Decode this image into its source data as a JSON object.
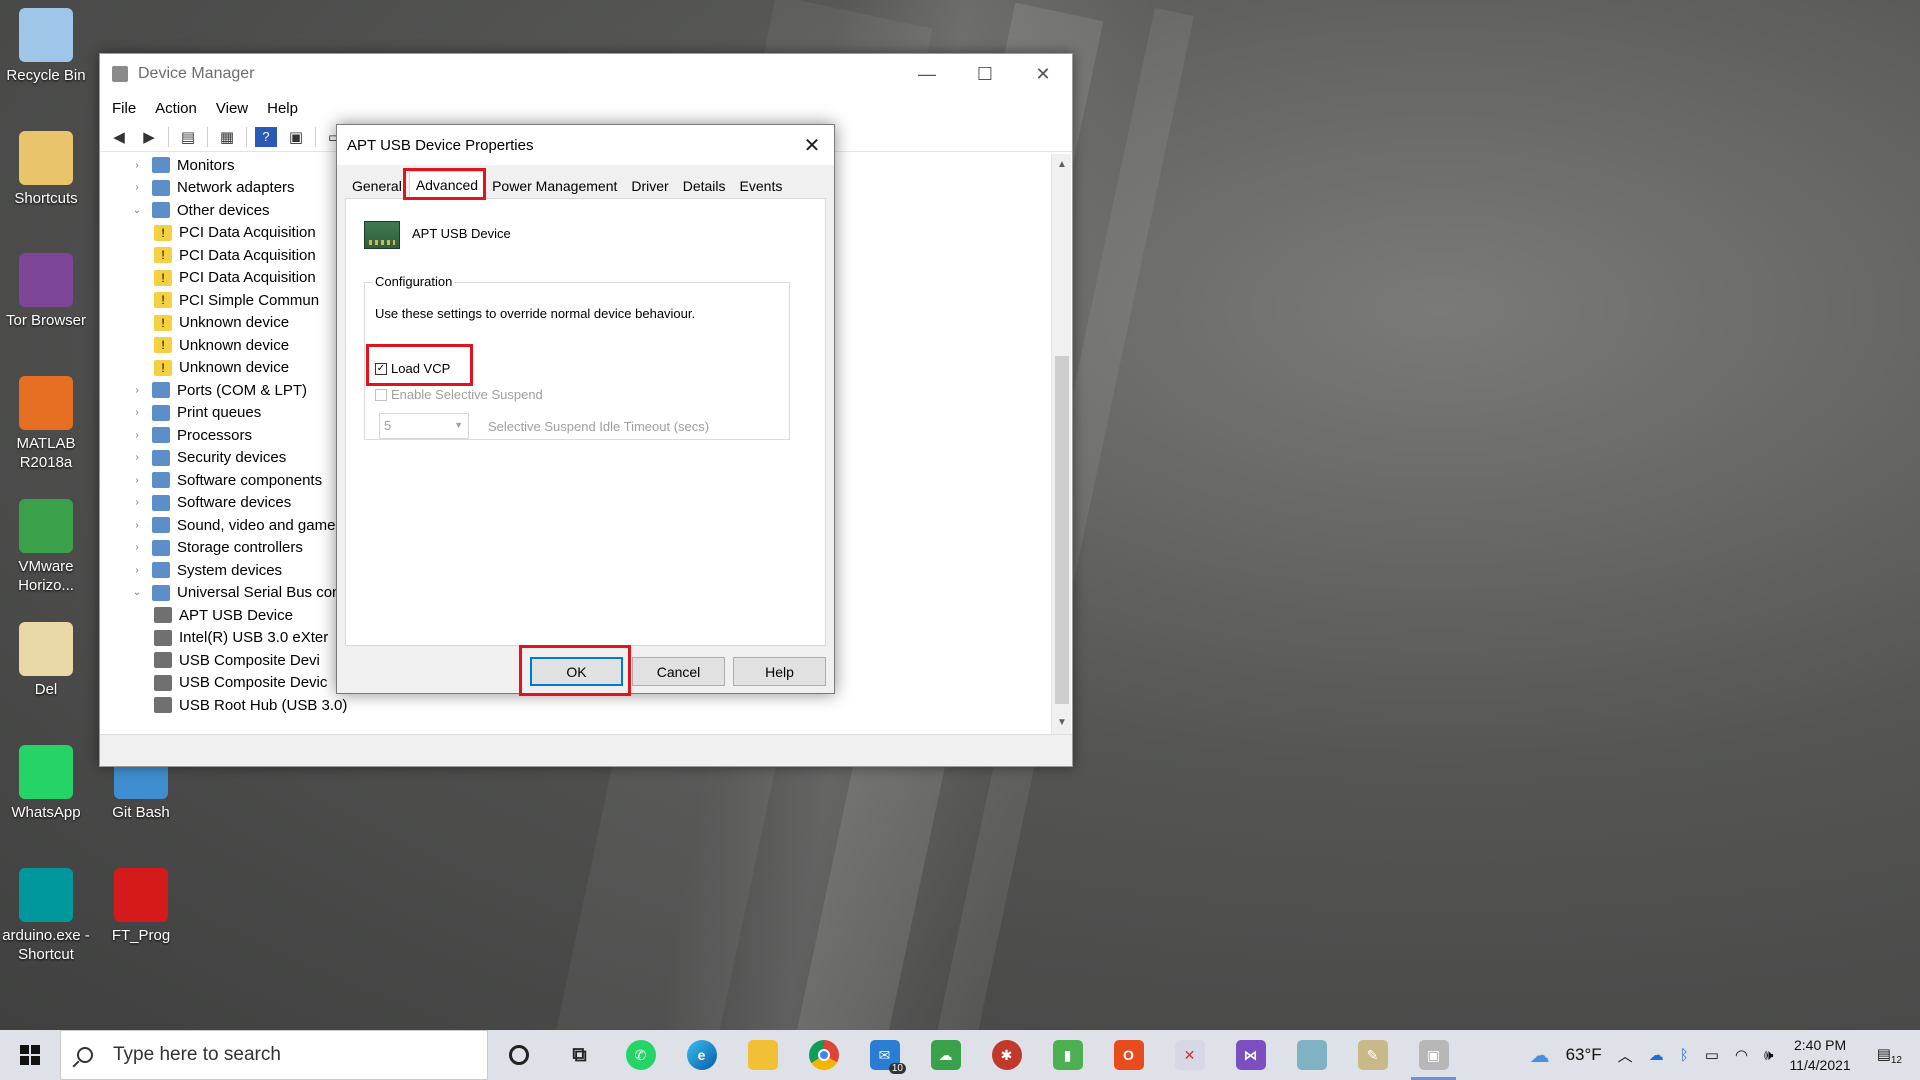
{
  "desktop": {
    "icons": [
      {
        "label": "Recycle Bin",
        "icon": "recycle-bin-icon",
        "color": "#9fc6e8"
      },
      {
        "label": "Shortcuts",
        "icon": "folder-icon",
        "color": "#e9c46a"
      },
      {
        "label": "Tor Browser",
        "icon": "tor-icon",
        "color": "#7d4698"
      },
      {
        "label": "MATLAB R2018a",
        "icon": "matlab-icon",
        "color": "#e76f24"
      },
      {
        "label": "VMware Horizo...",
        "icon": "vmware-icon",
        "color": "#3aa14a"
      },
      {
        "label": "Del",
        "icon": "folder-icon",
        "color": "#e9d7a6"
      },
      {
        "label": "WhatsApp",
        "icon": "whatsapp-icon",
        "color": "#25d366"
      },
      {
        "label": "Git Bash",
        "icon": "git-bash-icon",
        "color": "#3f8fd0"
      },
      {
        "label": "arduino.exe - Shortcut",
        "icon": "arduino-icon",
        "color": "#00979d"
      },
      {
        "label": "FT_Prog",
        "icon": "ft-prog-icon",
        "color": "#d41a1a"
      }
    ]
  },
  "device_manager": {
    "title": "Device Manager",
    "menu": [
      "File",
      "Action",
      "View",
      "Help"
    ],
    "tree": [
      {
        "label": "Monitors",
        "expanded": false,
        "level": 0
      },
      {
        "label": "Network adapters",
        "expanded": false,
        "level": 0
      },
      {
        "label": "Other devices",
        "expanded": true,
        "level": 0
      },
      {
        "label": "PCI Data Acquisition",
        "level": 1,
        "warning": true
      },
      {
        "label": "PCI Data Acquisition",
        "level": 1,
        "warning": true
      },
      {
        "label": "PCI Data Acquisition",
        "level": 1,
        "warning": true
      },
      {
        "label": "PCI Simple Commun",
        "level": 1,
        "warning": true
      },
      {
        "label": "Unknown device",
        "level": 1,
        "warning": true
      },
      {
        "label": "Unknown device",
        "level": 1,
        "warning": true
      },
      {
        "label": "Unknown device",
        "level": 1,
        "warning": true
      },
      {
        "label": "Ports (COM & LPT)",
        "expanded": false,
        "level": 0
      },
      {
        "label": "Print queues",
        "expanded": false,
        "level": 0
      },
      {
        "label": "Processors",
        "expanded": false,
        "level": 0
      },
      {
        "label": "Security devices",
        "expanded": false,
        "level": 0
      },
      {
        "label": "Software components",
        "expanded": false,
        "level": 0
      },
      {
        "label": "Software devices",
        "expanded": false,
        "level": 0
      },
      {
        "label": "Sound, video and game",
        "expanded": false,
        "level": 0
      },
      {
        "label": "Storage controllers",
        "expanded": false,
        "level": 0
      },
      {
        "label": "System devices",
        "expanded": false,
        "level": 0
      },
      {
        "label": "Universal Serial Bus cont",
        "expanded": true,
        "level": 0
      },
      {
        "label": "APT USB Device",
        "level": 1
      },
      {
        "label": "Intel(R) USB 3.0 eXter",
        "level": 1
      },
      {
        "label": "USB Composite Devi",
        "level": 1
      },
      {
        "label": "USB Composite Devic",
        "level": 1
      },
      {
        "label": "USB Root Hub (USB 3.0)",
        "level": 1
      }
    ]
  },
  "dialog": {
    "title": "APT USB Device Properties",
    "tabs": [
      "General",
      "Advanced",
      "Power Management",
      "Driver",
      "Details",
      "Events"
    ],
    "active_tab": "Advanced",
    "device_name": "APT USB Device",
    "group_title": "Configuration",
    "description": "Use these settings to override normal device behaviour.",
    "load_vcp": {
      "label": "Load VCP",
      "checked": true
    },
    "selective_suspend": {
      "label": "Enable Selective Suspend",
      "checked": false,
      "enabled": false
    },
    "timeout": {
      "value": "5",
      "label": "Selective Suspend Idle Timeout (secs)",
      "enabled": false
    },
    "buttons": {
      "ok": "OK",
      "cancel": "Cancel",
      "help": "Help"
    },
    "highlight_color": "#e0141e"
  },
  "taskbar": {
    "search_placeholder": "Type here to search",
    "mail_badge": "10",
    "weather": "63°F",
    "time": "2:40 PM",
    "date": "11/4/2021",
    "notification_count": "12"
  }
}
